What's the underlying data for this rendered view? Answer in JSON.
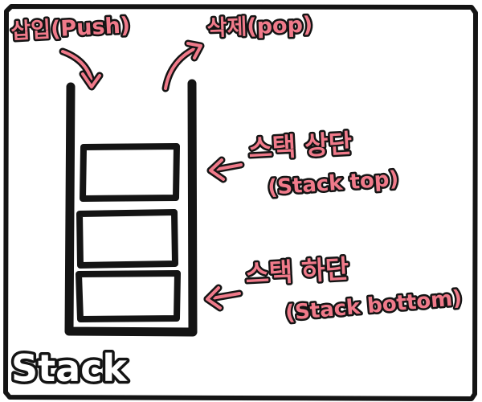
{
  "labels": {
    "push": "삽입(Push)",
    "pop": "삭제(pop)",
    "top_ko": "스택 상단",
    "top_en": "(Stack top)",
    "bottom_ko": "스택 하단",
    "bottom_en": "(Stack bottom)",
    "title": "Stack"
  },
  "colors": {
    "ink": "#141414",
    "accent": "#f07a8a",
    "background": "#ffffff"
  }
}
